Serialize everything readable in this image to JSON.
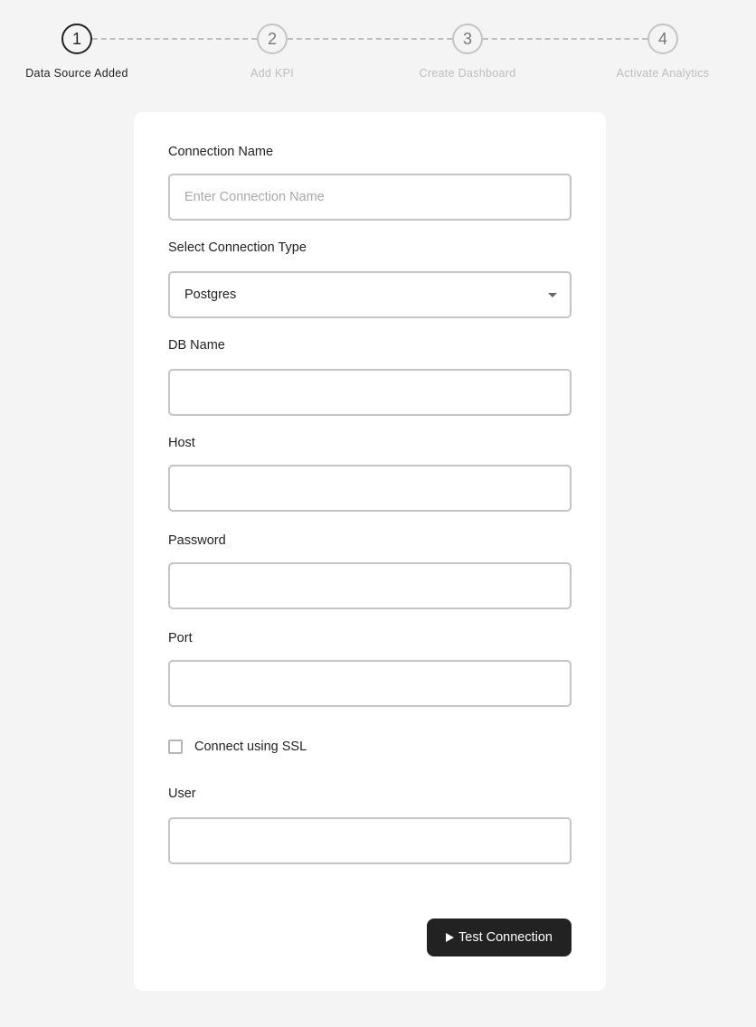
{
  "stepper": {
    "steps": [
      {
        "number": "1",
        "label": "Data Source Added",
        "state": "active"
      },
      {
        "number": "2",
        "label": "Add KPI",
        "state": "inactive"
      },
      {
        "number": "3",
        "label": "Create Dashboard",
        "state": "inactive"
      },
      {
        "number": "4",
        "label": "Activate Analytics",
        "state": "inactive"
      }
    ]
  },
  "form": {
    "connection_name": {
      "label": "Connection Name",
      "value": "",
      "placeholder": "Enter Connection Name"
    },
    "connection_type": {
      "label": "Select Connection Type",
      "value": "Postgres"
    },
    "db_name": {
      "label": "DB Name",
      "value": ""
    },
    "host": {
      "label": "Host",
      "value": ""
    },
    "password": {
      "label": "Password",
      "value": ""
    },
    "port": {
      "label": "Port",
      "value": ""
    },
    "ssl": {
      "label": "Connect using SSL",
      "checked": false
    },
    "user": {
      "label": "User",
      "value": ""
    },
    "test_button": {
      "label": "Test Connection",
      "icon": "play-icon"
    }
  }
}
